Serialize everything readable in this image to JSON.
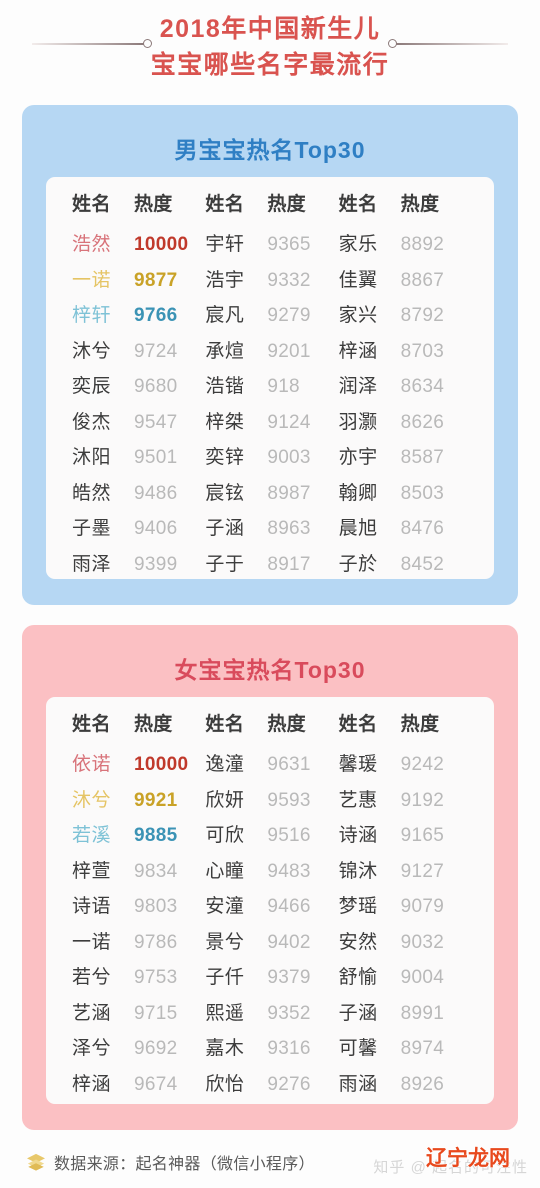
{
  "title": {
    "line1": "2018年中国新生儿",
    "line2": "宝宝哪些名字最流行",
    "color": "#d9534f"
  },
  "columns": {
    "name_header": "姓名",
    "score_header": "热度"
  },
  "boys": {
    "card_title": "男宝宝热名Top30",
    "card_bg": "#b6d7f3",
    "title_color": "#2f7fc4",
    "col1": [
      {
        "name": "浩然",
        "score": "10000"
      },
      {
        "name": "一诺",
        "score": "9877"
      },
      {
        "name": "梓轩",
        "score": "9766"
      },
      {
        "name": "沐兮",
        "score": "9724"
      },
      {
        "name": "奕辰",
        "score": "9680"
      },
      {
        "name": "俊杰",
        "score": "9547"
      },
      {
        "name": "沐阳",
        "score": "9501"
      },
      {
        "name": "皓然",
        "score": "9486"
      },
      {
        "name": "子墨",
        "score": "9406"
      },
      {
        "name": "雨泽",
        "score": "9399"
      }
    ],
    "col2": [
      {
        "name": "宇轩",
        "score": "9365"
      },
      {
        "name": "浩宇",
        "score": "9332"
      },
      {
        "name": "宸凡",
        "score": "9279"
      },
      {
        "name": "承煊",
        "score": "9201"
      },
      {
        "name": "浩锴",
        "score": "918"
      },
      {
        "name": "梓桀",
        "score": "9124"
      },
      {
        "name": "奕锌",
        "score": "9003"
      },
      {
        "name": "宸铉",
        "score": "8987"
      },
      {
        "name": "子涵",
        "score": "8963"
      },
      {
        "name": "子于",
        "score": "8917"
      }
    ],
    "col3": [
      {
        "name": "家乐",
        "score": "8892"
      },
      {
        "name": "佳翼",
        "score": "8867"
      },
      {
        "name": "家兴",
        "score": "8792"
      },
      {
        "name": "梓涵",
        "score": "8703"
      },
      {
        "name": "润泽",
        "score": "8634"
      },
      {
        "name": "羽灏",
        "score": "8626"
      },
      {
        "name": "亦宇",
        "score": "8587"
      },
      {
        "name": "翰卿",
        "score": "8503"
      },
      {
        "name": "晨旭",
        "score": "8476"
      },
      {
        "name": "子於",
        "score": "8452"
      }
    ]
  },
  "girls": {
    "card_title": "女宝宝热名Top30",
    "card_bg": "#fbc0c3",
    "title_color": "#d94b5c",
    "col1": [
      {
        "name": "依诺",
        "score": "10000"
      },
      {
        "name": "沐兮",
        "score": "9921"
      },
      {
        "name": "若溪",
        "score": "9885"
      },
      {
        "name": "梓萱",
        "score": "9834"
      },
      {
        "name": "诗语",
        "score": "9803"
      },
      {
        "name": "一诺",
        "score": "9786"
      },
      {
        "name": "若兮",
        "score": "9753"
      },
      {
        "name": "艺涵",
        "score": "9715"
      },
      {
        "name": "泽兮",
        "score": "9692"
      },
      {
        "name": "梓涵",
        "score": "9674"
      }
    ],
    "col2": [
      {
        "name": "逸潼",
        "score": "9631"
      },
      {
        "name": "欣妍",
        "score": "9593"
      },
      {
        "name": "可欣",
        "score": "9516"
      },
      {
        "name": "心瞳",
        "score": "9483"
      },
      {
        "name": "安潼",
        "score": "9466"
      },
      {
        "name": "景兮",
        "score": "9402"
      },
      {
        "name": "子仟",
        "score": "9379"
      },
      {
        "name": "熙遥",
        "score": "9352"
      },
      {
        "name": "嘉木",
        "score": "9316"
      },
      {
        "name": "欣怡",
        "score": "9276"
      }
    ],
    "col3": [
      {
        "name": "馨瑗",
        "score": "9242"
      },
      {
        "name": "艺惠",
        "score": "9192"
      },
      {
        "name": "诗涵",
        "score": "9165"
      },
      {
        "name": "锦沐",
        "score": "9127"
      },
      {
        "name": "梦瑶",
        "score": "9079"
      },
      {
        "name": "安然",
        "score": "9032"
      },
      {
        "name": "舒愉",
        "score": "9004"
      },
      {
        "name": "子涵",
        "score": "8991"
      },
      {
        "name": "可馨",
        "score": "8974"
      },
      {
        "name": "雨涵",
        "score": "8926"
      }
    ]
  },
  "footer": {
    "source_icon": "layers-icon",
    "source_text": "数据来源：起名神器（微信小程序）",
    "watermark_brand": "辽宁龙网",
    "watermark_faint": "知乎 @ 起名的可注性"
  },
  "highlight_colors": {
    "rank1_name": "#d8737a",
    "rank1_score": "#c0392b",
    "rank2_name": "#e5c464",
    "rank2_score": "#c9a227",
    "rank3_name": "#7ec2d6",
    "rank3_score": "#3b93b5"
  }
}
